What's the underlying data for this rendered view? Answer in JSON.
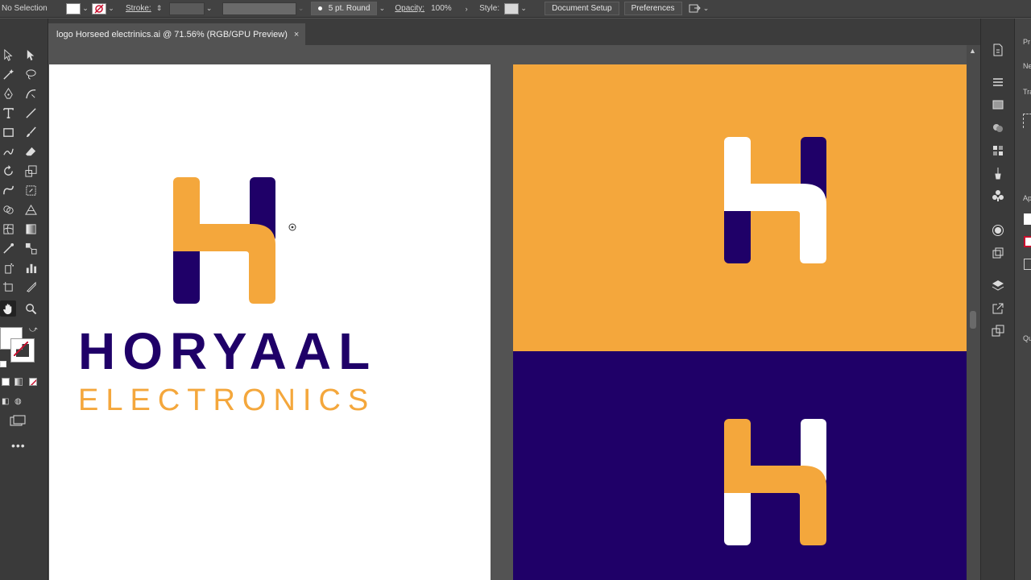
{
  "control_bar": {
    "selection": "No Selection",
    "stroke_label": "Stroke:",
    "brush": "5 pt. Round",
    "opacity_label": "Opacity:",
    "opacity_value": "100%",
    "style_label": "Style:",
    "document_setup": "Document Setup",
    "preferences": "Preferences"
  },
  "document_tab": {
    "title": "logo Horseed electrinics.ai @ 71.56% (RGB/GPU Preview)",
    "close": "×"
  },
  "artboard": {
    "wordmark_main": "HORYAAL",
    "wordmark_sub": "ELECTRONICS"
  },
  "panel_strip": {
    "labels": [
      "Pr",
      "Ne",
      "Tra",
      "Ap",
      "Qu"
    ]
  },
  "colors": {
    "orange": "#f4a73c",
    "navy": "#1f0068",
    "white": "#ffffff"
  }
}
